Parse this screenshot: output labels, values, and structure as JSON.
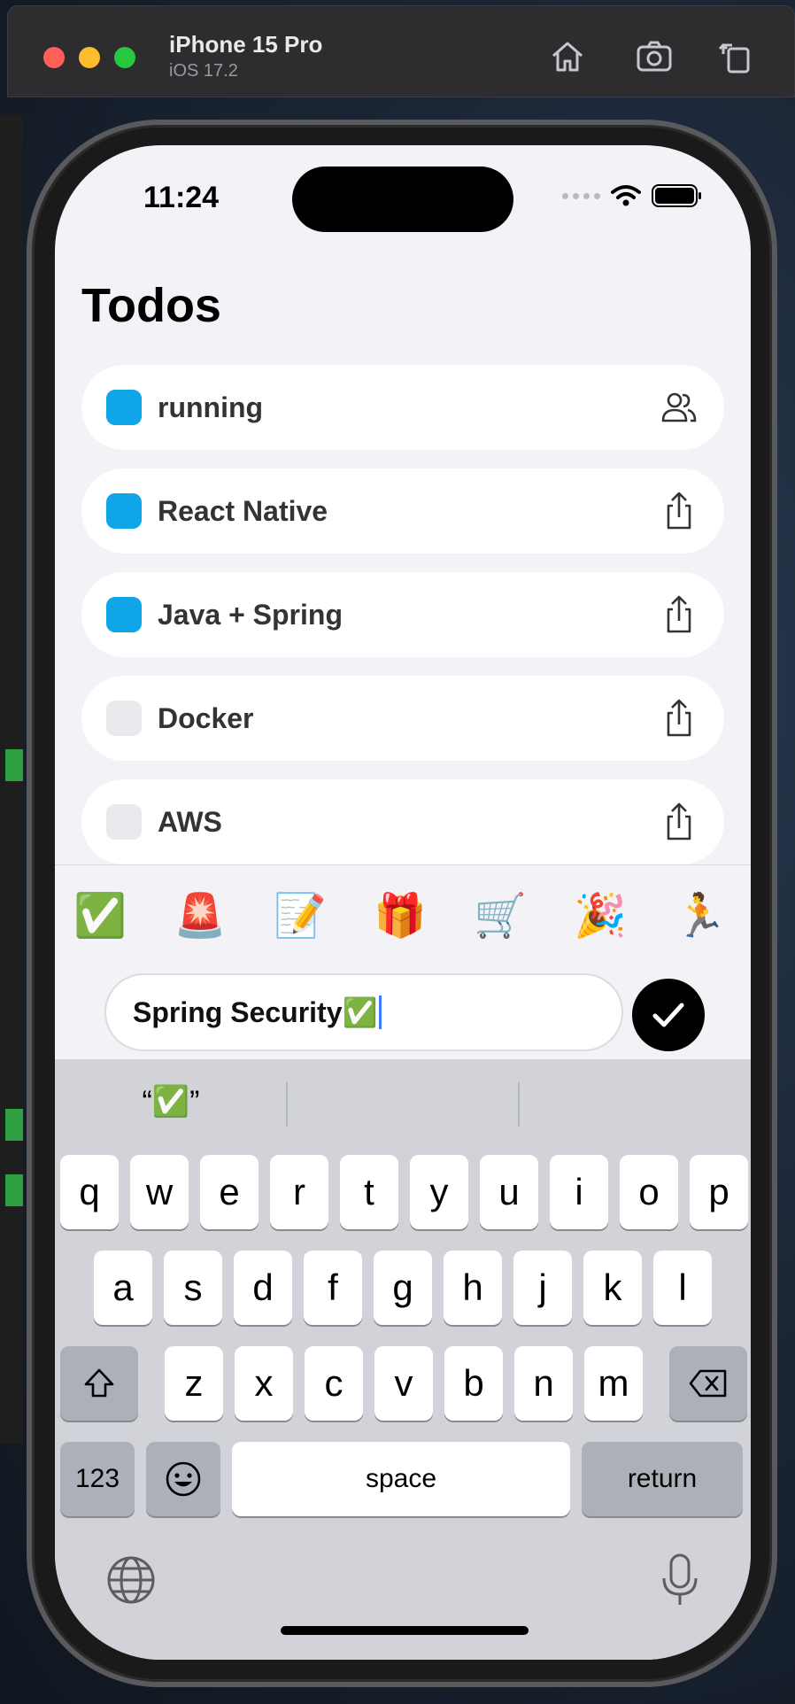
{
  "simulator": {
    "device_name": "iPhone 15 Pro",
    "os_version": "iOS 17.2",
    "tools": [
      "home-icon",
      "screenshot-icon",
      "rotate-icon"
    ]
  },
  "status_bar": {
    "time": "11:24"
  },
  "app": {
    "title": "Todos",
    "todos": [
      {
        "label": "running",
        "done": true,
        "icon": "people-icon"
      },
      {
        "label": "React Native",
        "done": true,
        "icon": "share-icon"
      },
      {
        "label": "Java + Spring",
        "done": true,
        "icon": "share-icon"
      },
      {
        "label": "Docker",
        "done": false,
        "icon": "share-icon"
      },
      {
        "label": "AWS",
        "done": false,
        "icon": "share-icon"
      }
    ],
    "emoji_bar": [
      "✅",
      "🚨",
      "📝",
      "🎁",
      "🛒",
      "🎉",
      "🏃"
    ],
    "entry": {
      "value": "Spring Security✅"
    }
  },
  "keyboard": {
    "prediction": "“✅”",
    "row1": [
      "q",
      "w",
      "e",
      "r",
      "t",
      "y",
      "u",
      "i",
      "o",
      "p"
    ],
    "row2": [
      "a",
      "s",
      "d",
      "f",
      "g",
      "h",
      "j",
      "k",
      "l"
    ],
    "row3": [
      "z",
      "x",
      "c",
      "v",
      "b",
      "n",
      "m"
    ],
    "numbers_label": "123",
    "space_label": "space",
    "return_label": "return"
  },
  "colors": {
    "accent_checkbox": "#0ea5e9",
    "screen_bg": "#f2f2f7",
    "keyboard_bg": "#d1d3d9"
  }
}
